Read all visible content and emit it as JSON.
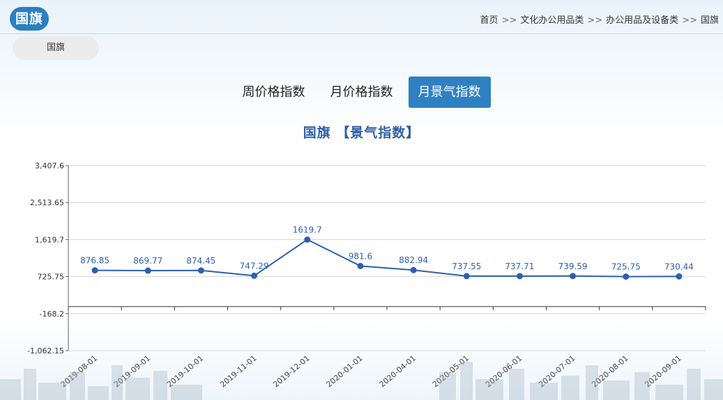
{
  "header": {
    "logo_text": "国旗",
    "breadcrumb": [
      "首页",
      "文化办公用品类",
      "办公用品及设备类",
      "国旗"
    ],
    "breadcrumb_sep": ">>"
  },
  "category_pill": "国旗",
  "tabs": [
    {
      "label": "周价格指数",
      "active": false
    },
    {
      "label": "月价格指数",
      "active": false
    },
    {
      "label": "月景气指数",
      "active": true
    }
  ],
  "colors": {
    "accent": "#2f80c2",
    "line": "#2d5fb0",
    "title": "#2f5fa8"
  },
  "chart_data": {
    "type": "line",
    "title": "国旗 【景气指数】",
    "categories": [
      "2019-08-01",
      "2019-09-01",
      "2019-10-01",
      "2019-11-01",
      "2019-12-01",
      "2020-01-01",
      "2020-04-01",
      "2020-05-01",
      "2020-06-01",
      "2020-07-01",
      "2020-08-01",
      "2020-09-01"
    ],
    "values": [
      876.85,
      869.77,
      874.45,
      747.29,
      1619.7,
      981.6,
      882.94,
      737.55,
      737.71,
      739.59,
      725.75,
      730.44
    ],
    "value_labels": [
      "876.85",
      "869.77",
      "874.45",
      "747.29",
      "1619.7",
      "981.6",
      "882.94",
      "737.55",
      "737.71",
      "739.59",
      "725.75",
      "730.44"
    ],
    "y_ticks": [
      "3,407.6",
      "2,513.65",
      "1,619.7",
      "725.75",
      "-168.2",
      "-1,062.15"
    ],
    "ylim": [
      -1062.15,
      3407.6
    ],
    "grid": true
  }
}
